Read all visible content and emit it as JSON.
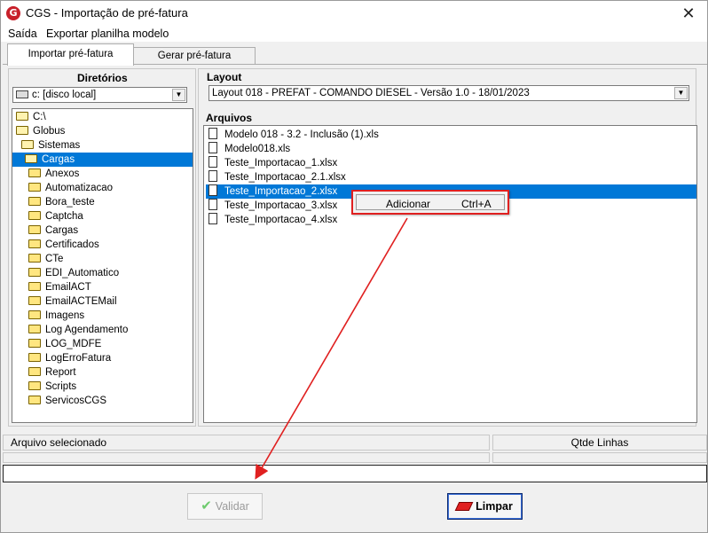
{
  "window": {
    "title": "CGS - Importação de pré-fatura",
    "app_icon_letter": "G",
    "close_glyph": "✕"
  },
  "menu": {
    "items": [
      "Saída",
      "Exportar planilha modelo"
    ]
  },
  "tabs": [
    "Importar pré-fatura",
    "Gerar pré-fatura"
  ],
  "directories": {
    "header": "Diretórios",
    "drive_selected": "c: [disco local]",
    "tree": [
      {
        "label": "C:\\",
        "level": 0,
        "open": true,
        "selected": false
      },
      {
        "label": "Globus",
        "level": 1,
        "open": true,
        "selected": false
      },
      {
        "label": "Sistemas",
        "level": 2,
        "open": true,
        "selected": false
      },
      {
        "label": "Cargas",
        "level": 3,
        "open": true,
        "selected": true
      },
      {
        "label": "Anexos",
        "level": 4,
        "open": false,
        "selected": false
      },
      {
        "label": "Automatizacao",
        "level": 4,
        "open": false,
        "selected": false
      },
      {
        "label": "Bora_teste",
        "level": 4,
        "open": false,
        "selected": false
      },
      {
        "label": "Captcha",
        "level": 4,
        "open": false,
        "selected": false
      },
      {
        "label": "Cargas",
        "level": 4,
        "open": false,
        "selected": false
      },
      {
        "label": "Certificados",
        "level": 4,
        "open": false,
        "selected": false
      },
      {
        "label": "CTe",
        "level": 4,
        "open": false,
        "selected": false
      },
      {
        "label": "EDI_Automatico",
        "level": 4,
        "open": false,
        "selected": false
      },
      {
        "label": "EmailACT",
        "level": 4,
        "open": false,
        "selected": false
      },
      {
        "label": "EmailACTEMail",
        "level": 4,
        "open": false,
        "selected": false
      },
      {
        "label": "Imagens",
        "level": 4,
        "open": false,
        "selected": false
      },
      {
        "label": "Log Agendamento",
        "level": 4,
        "open": false,
        "selected": false
      },
      {
        "label": "LOG_MDFE",
        "level": 4,
        "open": false,
        "selected": false
      },
      {
        "label": "LogErroFatura",
        "level": 4,
        "open": false,
        "selected": false
      },
      {
        "label": "Report",
        "level": 4,
        "open": false,
        "selected": false
      },
      {
        "label": "Scripts",
        "level": 4,
        "open": false,
        "selected": false
      },
      {
        "label": "ServicosCGS",
        "level": 4,
        "open": false,
        "selected": false
      }
    ]
  },
  "layout": {
    "header": "Layout",
    "selected": "Layout 018 - PREFAT - COMANDO DIESEL - Versão 1.0 - 18/01/2023"
  },
  "files": {
    "header": "Arquivos",
    "items": [
      {
        "name": "Modelo 018 - 3.2 - Inclusão (1).xls",
        "selected": false
      },
      {
        "name": "Modelo018.xls",
        "selected": false
      },
      {
        "name": "Teste_Importacao_1.xlsx",
        "selected": false
      },
      {
        "name": "Teste_Importacao_2.1.xlsx",
        "selected": false
      },
      {
        "name": "Teste_Importacao_2.xlsx",
        "selected": true
      },
      {
        "name": "Teste_Importacao_3.xlsx",
        "selected": false
      },
      {
        "name": "Teste_Importacao_4.xlsx",
        "selected": false
      }
    ]
  },
  "context_menu": {
    "label": "Adicionar",
    "shortcut": "Ctrl+A"
  },
  "status": {
    "selected_file_label": "Arquivo selecionado",
    "line_count_label": "Qtde Linhas",
    "input_value": ""
  },
  "buttons": {
    "validate": "Validar",
    "clear": "Limpar"
  },
  "colors": {
    "selection": "#0078d7",
    "annotation": "#e02020",
    "check": "#6ecb6e"
  }
}
